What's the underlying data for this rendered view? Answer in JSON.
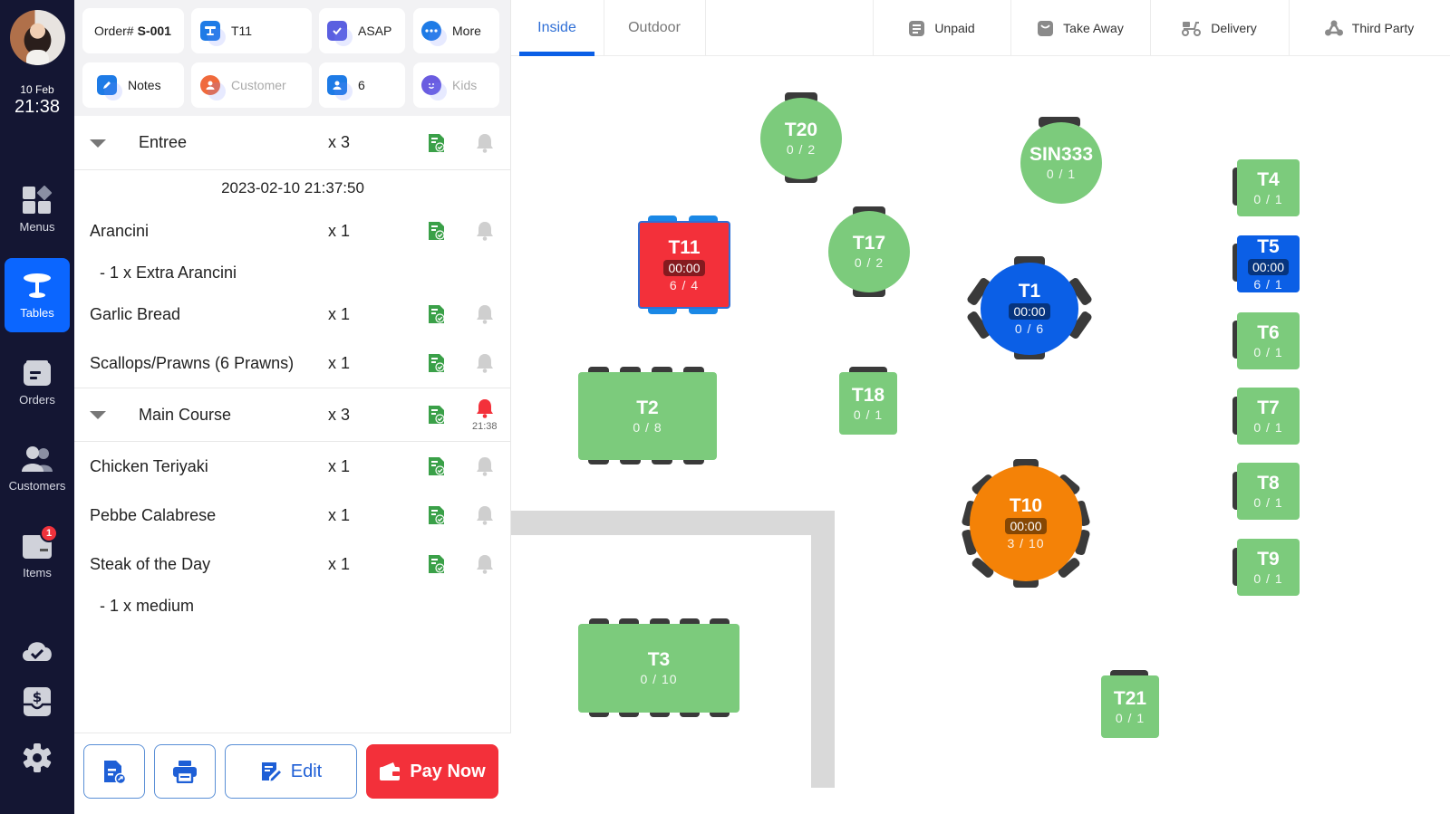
{
  "nav": {
    "date": "10 Feb",
    "time": "21:38",
    "items": [
      {
        "label": "Menus",
        "icon": "menus-grid-icon"
      },
      {
        "label": "Tables",
        "icon": "table-icon",
        "active": true
      },
      {
        "label": "Orders",
        "icon": "orders-icon"
      },
      {
        "label": "Customers",
        "icon": "customers-icon"
      },
      {
        "label": "Items",
        "icon": "items-icon",
        "badge": "1"
      }
    ],
    "bottom_icons": [
      "cloud-sync-icon",
      "cash-drawer-icon",
      "settings-gear-icon"
    ]
  },
  "order": {
    "order_prefix": "Order#",
    "order_number": "S-001",
    "table": "T11",
    "timing": "ASAP",
    "more": "More",
    "notes": "Notes",
    "customer_placeholder": "Customer",
    "guests": "6",
    "kids_placeholder": "Kids",
    "groups": [
      {
        "name": "Entree",
        "qty": "x 3",
        "timestamp": "2023-02-10 21:37:50",
        "items": [
          {
            "name": "Arancini",
            "qty": "x 1",
            "modifiers": [
              "- 1 x Extra Arancini"
            ]
          },
          {
            "name": "Garlic Bread",
            "qty": "x 1",
            "modifiers": []
          },
          {
            "name": "Scallops/Prawns (6 Prawns)",
            "qty": "x 1",
            "modifiers": []
          }
        ]
      },
      {
        "name": "Main Course",
        "qty": "x 3",
        "bell_time": "21:38",
        "bell_active": true,
        "items": [
          {
            "name": "Chicken Teriyaki",
            "qty": "x 1",
            "modifiers": []
          },
          {
            "name": "Pebbe Calabrese",
            "qty": "x 1",
            "modifiers": []
          },
          {
            "name": "Steak of the Day",
            "qty": "x 1",
            "modifiers": [
              "- 1 x medium"
            ]
          }
        ]
      }
    ],
    "footer": {
      "edit": "Edit",
      "pay_now": "Pay Now"
    }
  },
  "floor": {
    "tabs": [
      {
        "label": "Inside",
        "active": true
      },
      {
        "label": "Outdoor",
        "active": false
      }
    ],
    "filters": [
      {
        "label": "Unpaid",
        "icon": "unpaid-receipt-icon"
      },
      {
        "label": "Take Away",
        "icon": "take-away-bag-icon"
      },
      {
        "label": "Delivery",
        "icon": "delivery-scooter-icon"
      },
      {
        "label": "Third Party",
        "icon": "third-party-icon"
      }
    ],
    "tables": {
      "T20": {
        "name": "T20",
        "seats": "0 / 2",
        "status": "free"
      },
      "SIN333": {
        "name": "SIN333",
        "seats": "0 / 1",
        "status": "free"
      },
      "T4": {
        "name": "T4",
        "seats": "0 / 1",
        "status": "free"
      },
      "T11": {
        "name": "T11",
        "time": "00:00",
        "seats": "6 / 4",
        "status": "selected"
      },
      "T17": {
        "name": "T17",
        "seats": "0 / 2",
        "status": "free"
      },
      "T5": {
        "name": "T5",
        "time": "00:00",
        "seats": "6 / 1",
        "status": "occupied"
      },
      "T1": {
        "name": "T1",
        "time": "00:00",
        "seats": "0 / 6",
        "status": "occupied"
      },
      "T6": {
        "name": "T6",
        "seats": "0 / 1",
        "status": "free"
      },
      "T2": {
        "name": "T2",
        "seats": "0 / 8",
        "status": "free"
      },
      "T18": {
        "name": "T18",
        "seats": "0 / 1",
        "status": "free"
      },
      "T7": {
        "name": "T7",
        "seats": "0 / 1",
        "status": "free"
      },
      "T8": {
        "name": "T8",
        "seats": "0 / 1",
        "status": "free"
      },
      "T10": {
        "name": "T10",
        "time": "00:00",
        "seats": "3 / 10",
        "status": "partial"
      },
      "T9": {
        "name": "T9",
        "seats": "0 / 1",
        "status": "free"
      },
      "T3": {
        "name": "T3",
        "seats": "0 / 10",
        "status": "free"
      },
      "T21": {
        "name": "T21",
        "seats": "0 / 1",
        "status": "free"
      }
    },
    "colors": {
      "free": "#7ccb7c",
      "selected": "#f3303a",
      "occupied": "#0b5fe6",
      "partial": "#f48207"
    }
  }
}
